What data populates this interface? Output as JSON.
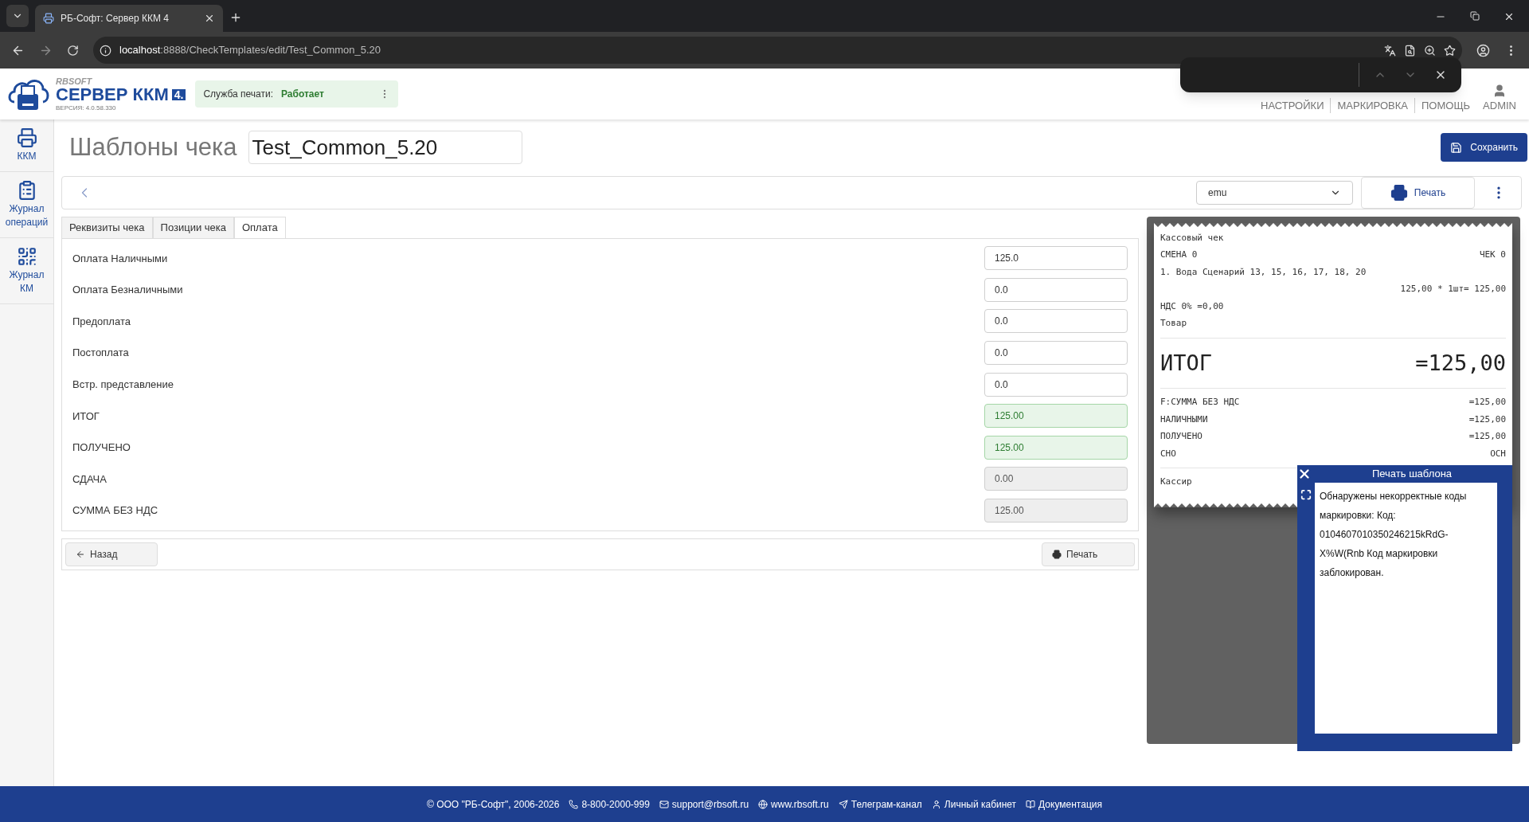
{
  "browser": {
    "tab_title": "РБ-Софт: Сервер ККМ 4",
    "url_host": "localhost",
    "url_rest": ":8888/CheckTemplates/edit/Test_Common_5.20"
  },
  "header": {
    "brand": "RBSOFT",
    "product": "СЕРВЕР ККМ",
    "product_badge": "4.",
    "version": "ВЕРСИЯ: 4.0.58.330",
    "service_label": "Служба печати:",
    "service_status": "Работает",
    "nav": [
      "НАСТРОЙКИ",
      "МАРКИРОВКА",
      "ПОМОЩЬ"
    ],
    "user": "ADMIN"
  },
  "sidebar": {
    "items": [
      {
        "label": "ККМ"
      },
      {
        "label": "Журнал операций"
      },
      {
        "label": "Журнал КМ"
      }
    ]
  },
  "page": {
    "title": "Шаблоны чека",
    "template_name": "Test_Common_5.20",
    "save_button": "Сохранить"
  },
  "toolbar": {
    "printer": "emu",
    "print_button": "Печать"
  },
  "tabs": [
    {
      "label": "Реквизиты чека",
      "selected": false
    },
    {
      "label": "Позиции чека",
      "selected": false
    },
    {
      "label": "Оплата",
      "selected": true
    }
  ],
  "payment_fields": [
    {
      "label": "Оплата Наличными",
      "value": "125.0",
      "kind": "editable"
    },
    {
      "label": "Оплата Безналичными",
      "value": "0.0",
      "kind": "editable"
    },
    {
      "label": "Предоплата",
      "value": "0.0",
      "kind": "editable"
    },
    {
      "label": "Постоплата",
      "value": "0.0",
      "kind": "editable"
    },
    {
      "label": "Встр. представление",
      "value": "0.0",
      "kind": "editable"
    },
    {
      "label": "ИТОГ",
      "value": "125.00",
      "kind": "valid"
    },
    {
      "label": "ПОЛУЧЕНО",
      "value": "125.00",
      "kind": "valid"
    },
    {
      "label": "СДАЧА",
      "value": "0.00",
      "kind": "readonly"
    },
    {
      "label": "СУММА БЕЗ НДС",
      "value": "125.00",
      "kind": "readonly"
    }
  ],
  "bottom_buttons": {
    "back": "Назад",
    "print": "Печать"
  },
  "receipt": {
    "lines": [
      {
        "kind": "text",
        "left": "Кассовый чек"
      },
      {
        "kind": "pair",
        "left": "СМЕНА 0",
        "right": "ЧЕК 0"
      },
      {
        "kind": "text",
        "left": "1. Вода Сценарий 13, 15, 16, 17, 18, 20"
      },
      {
        "kind": "right",
        "right": "125,00 * 1шт= 125,00"
      },
      {
        "kind": "text",
        "left": "НДС 0% =0,00"
      },
      {
        "kind": "text",
        "left": "Товар"
      },
      {
        "kind": "separator"
      },
      {
        "kind": "total",
        "left": "ИТОГ",
        "right": "=125,00"
      },
      {
        "kind": "separator"
      },
      {
        "kind": "pair",
        "left": "F:СУММА БЕЗ НДС",
        "right": "=125,00"
      },
      {
        "kind": "pair",
        "left": "НАЛИЧНЫМИ",
        "right": "=125,00"
      },
      {
        "kind": "pair",
        "left": "ПОЛУЧЕНО",
        "right": "=125,00"
      },
      {
        "kind": "pair",
        "left": "СНО",
        "right": "ОСН"
      },
      {
        "kind": "separator"
      },
      {
        "kind": "text",
        "left": "Кассир"
      }
    ]
  },
  "dialog": {
    "title": "Печать шаблона",
    "message": "Обнаружены некорректные коды маркировки: Код: 0104607010350246215kRdG-X%W(Rnb Код маркировки заблокирован."
  },
  "footer": [
    "© ООО \"РБ-Софт\", 2006-2026",
    "8-800-2000-999",
    "support@rbsoft.ru",
    "www.rbsoft.ru",
    "Телеграм-канал",
    "Личный кабинет",
    "Документация"
  ]
}
